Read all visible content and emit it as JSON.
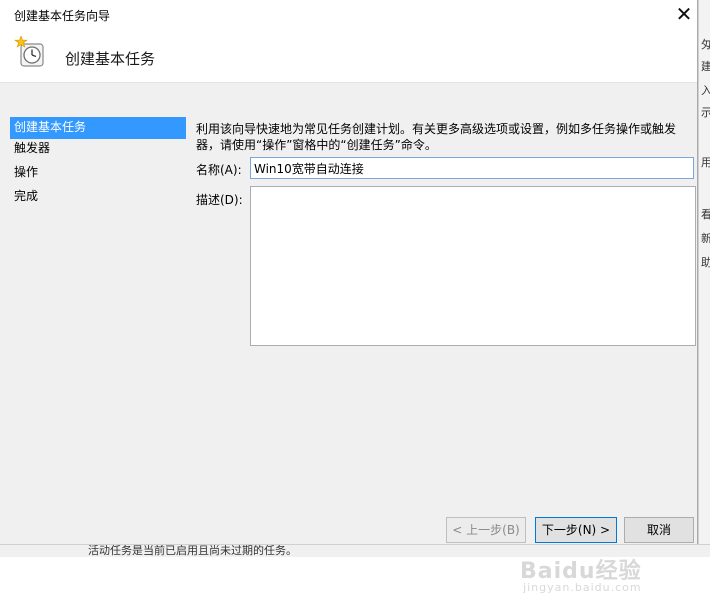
{
  "dialog": {
    "title": "创建基本任务向导",
    "close_label": "✕",
    "heading": "创建基本任务"
  },
  "steps": [
    {
      "label": "创建基本任务",
      "active": true
    },
    {
      "label": "触发器",
      "active": false
    },
    {
      "label": "操作",
      "active": false
    },
    {
      "label": "完成",
      "active": false
    }
  ],
  "main": {
    "intro_line1": "利用该向导快速地为常见任务创建计划。有关更多高级选项或设置，例如多任务操作或触发",
    "intro_line2": "器，请使用“操作”窗格中的“创建任务”命令。",
    "name_label": "名称(A):",
    "name_value": "Win10宽带自动连接",
    "description_label": "描述(D):",
    "description_value": ""
  },
  "buttons": {
    "back": "< 上一步(B)",
    "next": "下一步(N) >",
    "cancel": "取消"
  },
  "background_window": {
    "right_fragments": [
      "匁",
      "建",
      "入",
      "示",
      "用",
      "看",
      "新",
      "助"
    ],
    "bottom_text": "活动任务是当前已启用且尚未过期的任务。"
  },
  "watermark": {
    "text": "Baidu经验",
    "subtext": "jingyan.baidu.com"
  },
  "colors": {
    "accent": "#3399ff",
    "content_bg": "#f0f0f0",
    "input_focus_border": "#7aa7d8"
  }
}
